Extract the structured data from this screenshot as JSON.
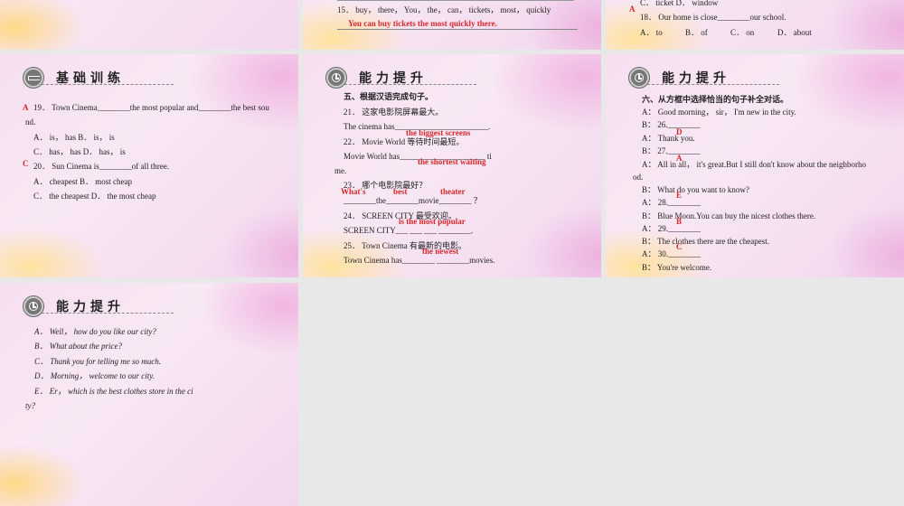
{
  "slide_2_top": {
    "q15": "15． buy， there， You， the， can， tickets， most， quickly",
    "q15_answer": "You can buy tickets the most quickly there."
  },
  "slide_3_top": {
    "answer_17": "A",
    "q17_options": "C． ticket D． window",
    "q18": "18． Our home is close________our school.",
    "q18_options": [
      "A． to",
      "B． of",
      "C． on",
      "D． about"
    ]
  },
  "slide_4": {
    "title": "基础训练",
    "q19_answer": "A",
    "q19": "19． Town Cinema________the most popular and________the best sou",
    "q19_cont": "nd.",
    "q19_opt1": "A． is， has B． is， is",
    "q19_opt2": "C． has， has D． has， is",
    "q20_answer": "C",
    "q20": "20． Sun Cinema is________of all three.",
    "q20_opt1": "A． cheapest B． most cheap",
    "q20_opt2": "C． the cheapest D． the most cheap"
  },
  "slide_5": {
    "title": "能力提升",
    "instruction": "五、根据汉语完成句子。",
    "q21": "21． 这家电影院屏幕最大。",
    "q21_line": "The cinema has_______________________.",
    "q21_answer": "the biggest screens",
    "q22": "22． Movie World 等待时间最短。",
    "q22_line": "Movie World has_____________________ ti",
    "q22_answer": "the shortest waiting",
    "q22_cont": "me.",
    "q23": "23． 哪个电影院最好？",
    "q23_answers": [
      "What's",
      "best",
      "theater"
    ],
    "q23_line": "________the________movie________ ？",
    "q24": "24． SCREEN CITY 最受欢迎。",
    "q24_answer": "is the most popular",
    "q24_line": "SCREEN CITY___ ___ ___ ________.",
    "q25": "25． Town Cinema  有最新的电影。",
    "q25_answer": "the newest",
    "q25_line": "Town Cinema has________ ________movies."
  },
  "slide_6": {
    "title": "能力提升",
    "instruction": "六、从方框中选择恰当的句子补全对话。",
    "lines": [
      "A： Good morning， sir， I'm new in the city.",
      "B： 26.________",
      "A： Thank you.",
      "B： 27.________",
      "A： All in all， it's great.But I still don't know about the neighborho",
      "od.",
      "B： What do you want to know?",
      "A： 28.________",
      "B： Blue Moon.You can buy the nicest clothes there.",
      "A： 29.________",
      "B： The clothes there are the cheapest.",
      "A： 30.________",
      "B： You're welcome."
    ],
    "answers": [
      "D",
      "A",
      "E",
      "B",
      "C"
    ]
  },
  "slide_7": {
    "title": "能力提升",
    "options": [
      "A． Well， how do you like our city?",
      "B． What about the price?",
      "C． Thank you for telling me so much.",
      "D． Morning， welcome to our city.",
      "E． Er， which is the best clothes store in the ci",
      "ty?"
    ]
  }
}
